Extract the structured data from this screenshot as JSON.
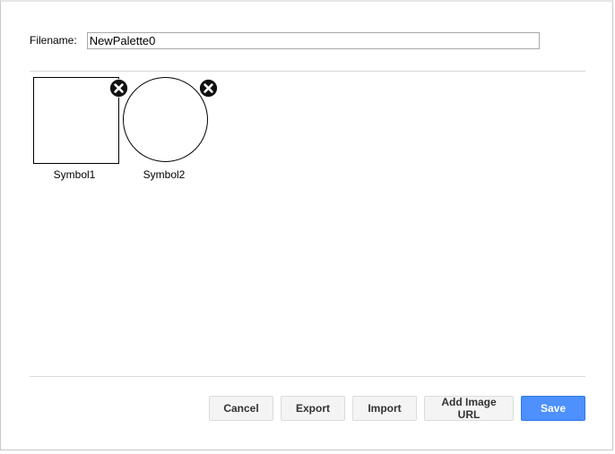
{
  "dialog": {
    "filename_label": "Filename:",
    "filename_value": "NewPalette0"
  },
  "symbols": [
    {
      "label": "Symbol1",
      "shape": "square",
      "delete_icon": "close-circle-icon"
    },
    {
      "label": "Symbol2",
      "shape": "circle",
      "delete_icon": "close-circle-icon"
    }
  ],
  "buttons": {
    "cancel": "Cancel",
    "export": "Export",
    "import": "Import",
    "add_image_url": "Add Image URL",
    "save": "Save"
  },
  "colors": {
    "primary": "#4d90fe",
    "primary_border": "#3079ed",
    "secondary_bg": "#f4f4f4",
    "divider": "#dadada"
  }
}
